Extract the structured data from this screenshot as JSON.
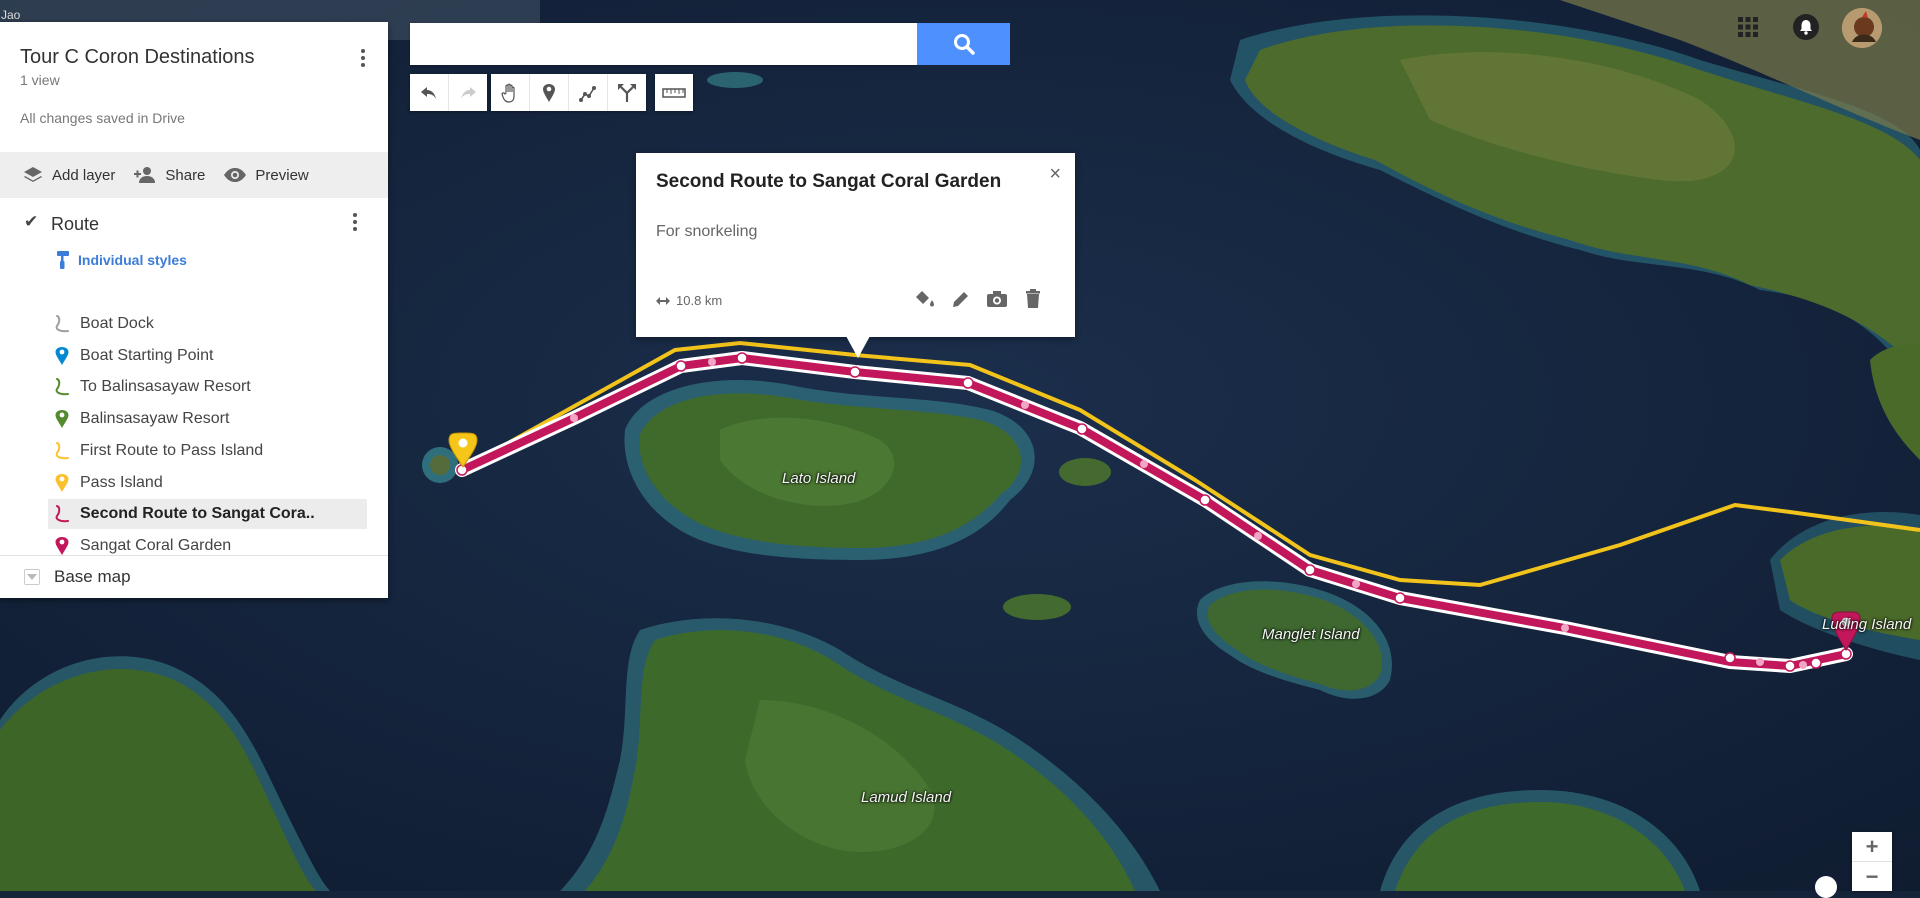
{
  "map": {
    "corner_text": "Jao",
    "labels": {
      "lato": "Lato Island",
      "manglet": "Manglet Island",
      "lamud": "Lamud Island",
      "luding": "Luding Island"
    }
  },
  "panel": {
    "title": "Tour C Coron Destinations",
    "views": "1 view",
    "saved": "All changes saved in Drive",
    "actions": {
      "add_layer": "Add layer",
      "share": "Share",
      "preview": "Preview"
    },
    "layer": {
      "title": "Route",
      "styles_label": "Individual styles",
      "items": [
        {
          "label": "Boat Dock",
          "kind": "route",
          "color": "#9e9e9e"
        },
        {
          "label": "Boat Starting Point",
          "kind": "pin",
          "color": "#0288d1"
        },
        {
          "label": "To Balinsasayaw Resort",
          "kind": "route",
          "color": "#558b2f"
        },
        {
          "label": "Balinsasayaw Resort",
          "kind": "pin",
          "color": "#558b2f"
        },
        {
          "label": "First Route to Pass Island",
          "kind": "route",
          "color": "#fbc02d"
        },
        {
          "label": "Pass Island",
          "kind": "pin",
          "color": "#fbc02d"
        },
        {
          "label": "Second Route to Sangat Cora..",
          "kind": "route",
          "color": "#c2185b"
        },
        {
          "label": "Sangat Coral Garden",
          "kind": "pin",
          "color": "#c2185b"
        }
      ]
    },
    "base_map": "Base map"
  },
  "search": {
    "placeholder": "",
    "value": ""
  },
  "infowindow": {
    "title": "Second Route to Sangat Coral Garden",
    "description": "For snorkeling",
    "distance": "10.8 km",
    "close": "×"
  },
  "zoom": {
    "in": "+",
    "out": "−"
  },
  "colors": {
    "accent": "#4d90fe",
    "route_selected": "#c2185b",
    "route_yellow": "#f2c31b",
    "styles_link": "#3b7dd8"
  }
}
